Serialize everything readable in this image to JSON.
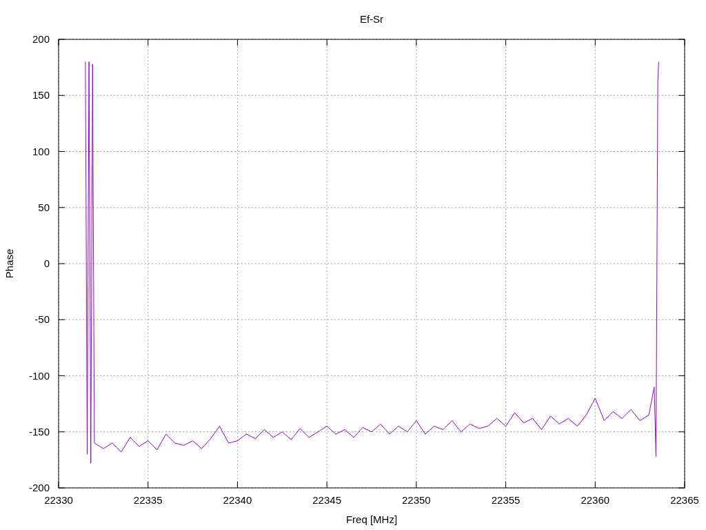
{
  "chart_data": {
    "type": "line",
    "title": "Ef-Sr",
    "xlabel": "Freq [MHz]",
    "ylabel": "Phase",
    "x": [
      22331.5,
      22331.6,
      22331.7,
      22331.8,
      22331.9,
      22332.0,
      22332.5,
      22333,
      22333.5,
      22334,
      22334.5,
      22335,
      22335.5,
      22336,
      22336.5,
      22337,
      22337.5,
      22338,
      22338.5,
      22339,
      22339.5,
      22340,
      22340.5,
      22341,
      22341.5,
      22342,
      22342.5,
      22343,
      22343.5,
      22344,
      22344.5,
      22345,
      22345.5,
      22346,
      22346.5,
      22347,
      22347.5,
      22348,
      22348.5,
      22349,
      22349.5,
      22350,
      22350.5,
      22351,
      22351.5,
      22352,
      22352.5,
      22353,
      22353.5,
      22354,
      22354.5,
      22355,
      22355.5,
      22356,
      22356.5,
      22357,
      22357.5,
      22358,
      22358.5,
      22359,
      22359.5,
      22360,
      22360.5,
      22361,
      22361.5,
      22362,
      22362.5,
      22363,
      22363.3,
      22363.4,
      22363.5,
      22363.55
    ],
    "grid": true,
    "series": [
      {
        "color": "#9400d3",
        "values": [
          180,
          -170,
          180,
          -178,
          178,
          -160,
          -165,
          -160,
          -168,
          -155,
          -163,
          -158,
          -166,
          -152,
          -160,
          -162,
          -158,
          -165,
          -156,
          -145,
          -160,
          -158,
          -152,
          -156,
          -148,
          -155,
          -150,
          -157,
          -147,
          -155,
          -150,
          -145,
          -152,
          -148,
          -155,
          -146,
          -150,
          -143,
          -152,
          -145,
          -150,
          -140,
          -152,
          -145,
          -148,
          -140,
          -150,
          -143,
          -147,
          -145,
          -138,
          -145,
          -133,
          -142,
          -138,
          -148,
          -136,
          -143,
          -138,
          -145,
          -135,
          -120,
          -140,
          -132,
          -138,
          -130,
          -140,
          -135,
          -110,
          -172,
          162,
          180
        ]
      }
    ],
    "xlim": [
      22330,
      22365
    ],
    "ylim": [
      -200,
      200
    ],
    "xticks": [
      22330,
      22335,
      22340,
      22345,
      22350,
      22355,
      22360,
      22365
    ],
    "yticks": [
      -200,
      -150,
      -100,
      -50,
      0,
      50,
      100,
      150,
      200
    ]
  }
}
